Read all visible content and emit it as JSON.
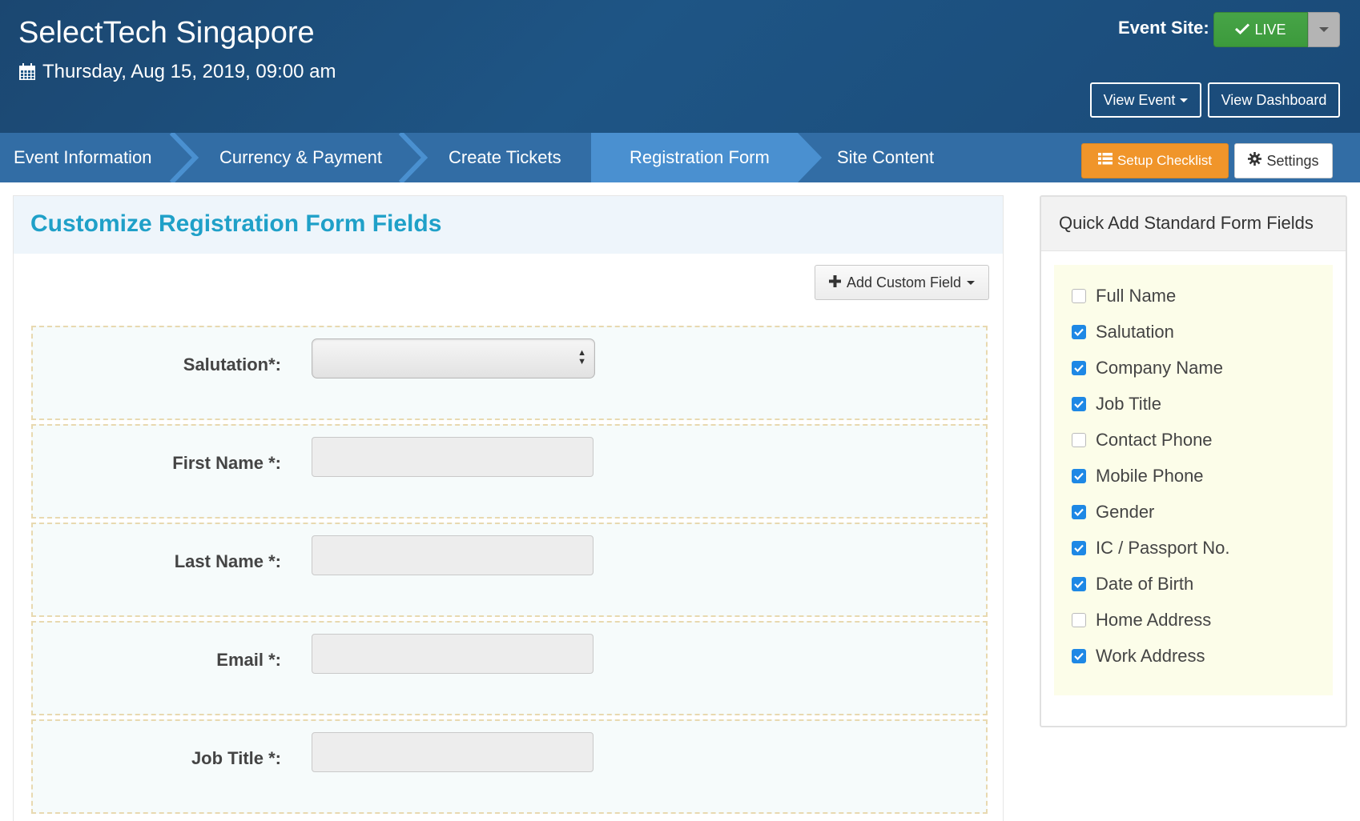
{
  "header": {
    "event_title": "SelectTech Singapore",
    "event_date": "Thursday, Aug 15, 2019, 09:00 am",
    "event_site_label": "Event Site:",
    "live_label": "LIVE",
    "view_event_label": "View Event",
    "view_dashboard_label": "View Dashboard"
  },
  "nav": {
    "steps": [
      {
        "label": "Event Information"
      },
      {
        "label": "Currency & Payment"
      },
      {
        "label": "Create Tickets"
      },
      {
        "label": "Registration Form",
        "active": true
      },
      {
        "label": "Site Content"
      }
    ],
    "setup_checklist_label": "Setup Checklist",
    "settings_label": "Settings"
  },
  "main": {
    "title": "Customize Registration Form Fields",
    "add_custom_field_label": "Add Custom Field",
    "fields": [
      {
        "label": "Salutation*:",
        "type": "select",
        "value": ""
      },
      {
        "label": "First Name *:",
        "type": "text",
        "value": ""
      },
      {
        "label": "Last Name *:",
        "type": "text",
        "value": ""
      },
      {
        "label": "Email *:",
        "type": "text",
        "value": ""
      },
      {
        "label": "Job Title *:",
        "type": "text",
        "value": ""
      }
    ]
  },
  "quick_add": {
    "title": "Quick Add Standard Form Fields",
    "items": [
      {
        "label": "Full Name",
        "checked": false
      },
      {
        "label": "Salutation",
        "checked": true
      },
      {
        "label": "Company Name",
        "checked": true
      },
      {
        "label": "Job Title",
        "checked": true
      },
      {
        "label": "Contact Phone",
        "checked": false
      },
      {
        "label": "Mobile Phone",
        "checked": true
      },
      {
        "label": "Gender",
        "checked": true
      },
      {
        "label": "IC / Passport No.",
        "checked": true
      },
      {
        "label": "Date of Birth",
        "checked": true
      },
      {
        "label": "Home Address",
        "checked": false
      },
      {
        "label": "Work Address",
        "checked": true
      }
    ]
  },
  "colors": {
    "header_bg": "#1e5585",
    "nav_bg": "#326da5",
    "nav_active": "#4a90d0",
    "live_green": "#47a447",
    "setup_orange": "#f0952a",
    "title_blue": "#1fa0c8",
    "checkbox_blue": "#1e88e5"
  },
  "icons": {
    "date": "calendar-icon",
    "live": "check-icon",
    "setup": "list-icon",
    "settings": "gear-icon",
    "add": "plus-icon"
  }
}
